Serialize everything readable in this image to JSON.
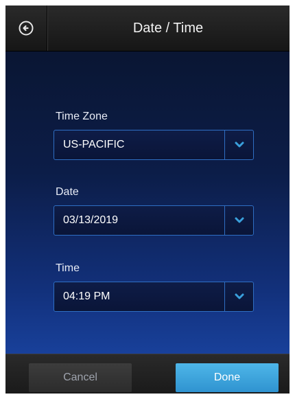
{
  "header": {
    "title": "Date / Time",
    "back_icon": "back-arrow-circle-icon"
  },
  "fields": {
    "time_zone": {
      "label": "Time Zone",
      "value": "US-PACIFIC"
    },
    "date": {
      "label": "Date",
      "value": "03/13/2019"
    },
    "time": {
      "label": "Time",
      "value": "04:19 PM"
    }
  },
  "footer": {
    "cancel_label": "Cancel",
    "done_label": "Done"
  },
  "colors": {
    "accent": "#3aa0dc",
    "done_button": "#3aa3dc",
    "border": "#2f6fc4",
    "background_top": "#0a1633",
    "background_bottom": "#18409a"
  }
}
